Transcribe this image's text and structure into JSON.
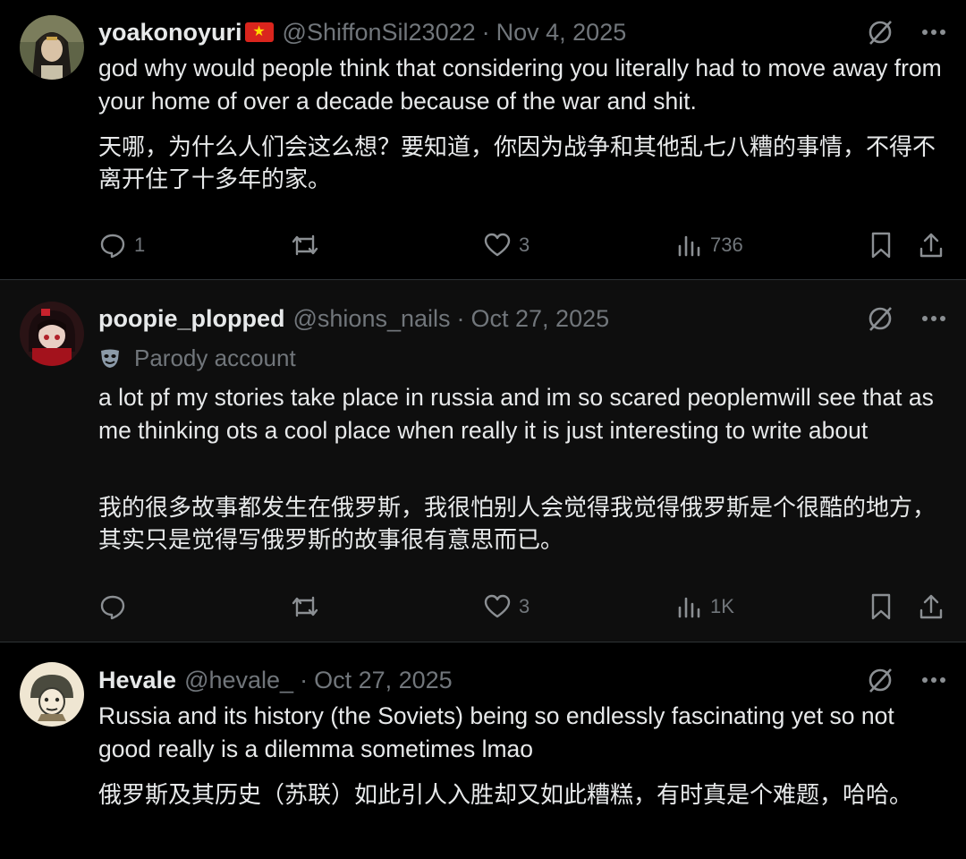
{
  "posts": [
    {
      "name": "yoakonoyuri",
      "flag": "★",
      "handle": "@ShiffonSil23022",
      "separator": "·",
      "date": "Nov 4, 2025",
      "text_en": "god why would people think that considering you literally had to move away from your home of over a decade because of the war and shit.",
      "text_zh": "天哪，为什么人们会这么想？要知道，你因为战争和其他乱七八糟的事情，不得不离开住了十多年的家。",
      "replies": "1",
      "reposts": "",
      "likes": "3",
      "views": "736"
    },
    {
      "name": "poopie_plopped",
      "handle": "@shions_nails",
      "separator": "·",
      "date": "Oct 27, 2025",
      "parody_label": "Parody account",
      "text_en": "a lot pf my stories take place in russia and im so scared peoplemwill see that as me thinking ots a cool place when really it is just interesting to write about",
      "text_zh": "我的很多故事都发生在俄罗斯，我很怕别人会觉得我觉得俄罗斯是个很酷的地方，其实只是觉得写俄罗斯的故事很有意思而已。",
      "replies": "",
      "reposts": "",
      "likes": "3",
      "views": "1K"
    },
    {
      "name": "Hevale",
      "handle": "@hevale_",
      "separator": "·",
      "date": "Oct 27, 2025",
      "text_en": "Russia and its history (the Soviets) being so endlessly fascinating yet so not good really is a dilemma sometimes lmao",
      "text_zh": "俄罗斯及其历史（苏联）如此引人入胜却又如此糟糕，有时真是个难题，哈哈。"
    }
  ],
  "colors": {
    "background": "#000000",
    "highlight_background": "#0e0e0e",
    "text": "#e7e9ea",
    "muted": "#71767b",
    "divider": "#2f3336"
  },
  "icons": {
    "grok": "grok-icon",
    "more": "more-icon",
    "reply": "reply-icon",
    "repost": "repost-icon",
    "like": "like-icon",
    "views": "views-icon",
    "bookmark": "bookmark-icon",
    "share": "share-icon",
    "parody": "parody-mask-icon"
  }
}
